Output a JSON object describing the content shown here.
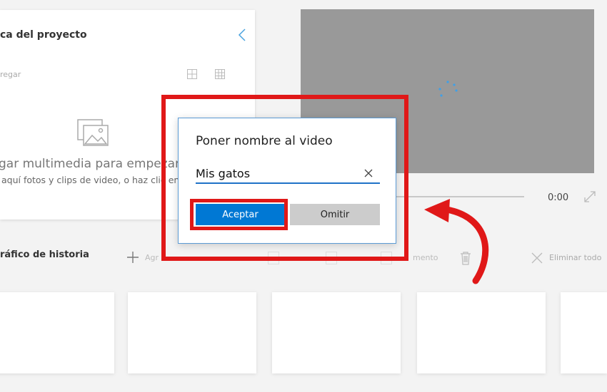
{
  "library": {
    "title": "ca del proyecto",
    "add_label": "regar",
    "empty_title": "gar multimedia para empezar",
    "empty_subtitle": "aquí fotos y clips de video, o haz clic en"
  },
  "preview": {
    "time": "0:00"
  },
  "storyboard": {
    "title": "ráfico de historia",
    "add_label": "Agr",
    "ghost_label": "mento",
    "delete_all_label": "Eliminar todo"
  },
  "dialog": {
    "title": "Poner nombre al video",
    "input_value": "Mis gatos",
    "accept_label": "Aceptar",
    "skip_label": "Omitir"
  },
  "colors": {
    "accent": "#0078d4",
    "annotation": "#e01818",
    "preview_bg": "#999999"
  },
  "icons": {
    "collapse": "chevron-left-icon",
    "media": "image-stack-icon",
    "clear": "close-icon",
    "add": "plus-icon",
    "trash": "trash-icon",
    "delete_all": "close-icon",
    "fullscreen": "expand-icon"
  }
}
